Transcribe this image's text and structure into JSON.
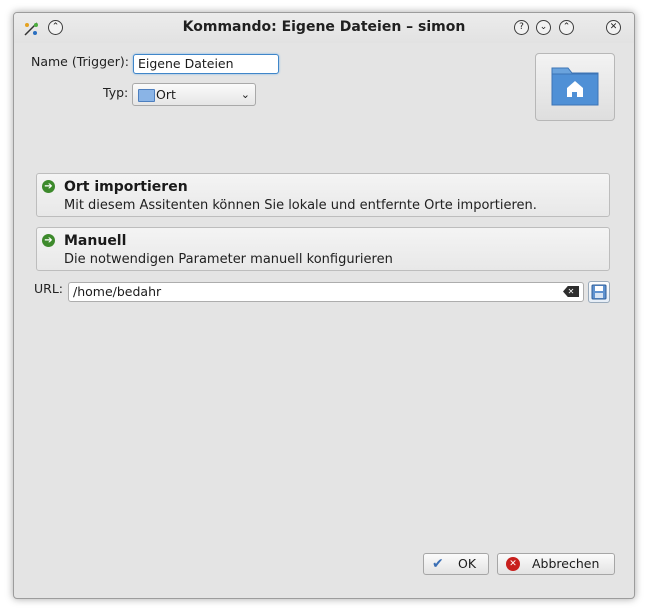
{
  "window": {
    "title": "Kommando: Eigene Dateien – simon",
    "controls": {
      "help": "?",
      "minimize": "⌄",
      "maximize": "⌃",
      "close": "✕",
      "keep_above": "⌃"
    }
  },
  "form": {
    "name_label": "Name (Trigger):",
    "name_value": "Eigene Dateien",
    "typ_label": "Typ:",
    "typ_value": "Ort",
    "url_label": "URL:",
    "url_value": "/home/bedahr"
  },
  "options": [
    {
      "title": "Ort importieren",
      "description": "Mit diesem Assitenten können Sie lokale und entfernte Orte importieren."
    },
    {
      "title": "Manuell",
      "description": "Die notwendigen Parameter manuell konfigurieren"
    }
  ],
  "buttons": {
    "ok": "OK",
    "cancel": "Abbrechen"
  },
  "icons": {
    "app": "simon-app-icon",
    "folder_home": "folder-home-icon",
    "arrow": "arrow-right-icon",
    "clear": "clear-text-icon",
    "save": "save-icon",
    "ok": "checkmark-icon",
    "cancel": "cancel-icon"
  },
  "colors": {
    "accent": "#3f86c9",
    "arrow": "#3d8a2c",
    "cancel": "#c8201d"
  }
}
